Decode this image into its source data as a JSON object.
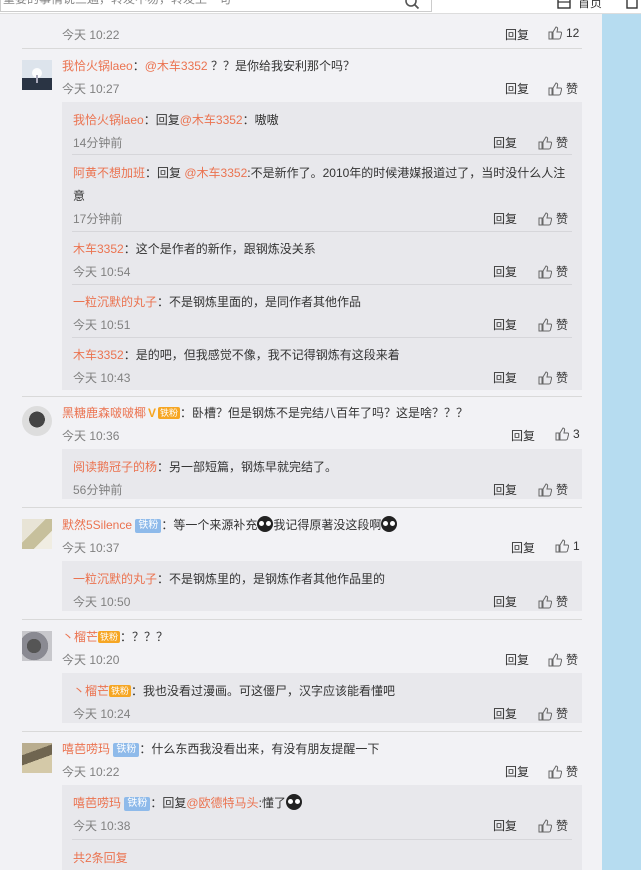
{
  "topbar": {
    "search_text": "重要的事情说三遍，转发不易，转发上一句",
    "home_label": "首页"
  },
  "labels": {
    "reply": "回复",
    "like_icon": "thumbs-up-icon"
  },
  "comments": [
    {
      "user": "",
      "text": "",
      "time": "今天 10:22",
      "likes": "12"
    },
    {
      "user": "我恰火锅laeo",
      "mention": "@木车3352",
      "text": "？？是你给我安利那个吗？",
      "time": "今天 10:27",
      "likes": "赞",
      "replies": [
        {
          "user": "我恰火锅laeo",
          "pre": "：回复",
          "mention": "@木车3352",
          "text": "：嗷嗷",
          "time": "14分钟前",
          "likes": "赞"
        },
        {
          "user": "阿黄不想加班",
          "pre": "：回复",
          "mention": "@木车3352",
          "text": ":不是新作了。2010年的时候港媒报道过了，当时没什么人注",
          "text2": "意",
          "time": "17分钟前",
          "likes": "赞"
        },
        {
          "user": "木车3352",
          "text": "：这个是作者的新作，跟钢炼没关系",
          "time": "今天 10:54",
          "likes": "赞"
        },
        {
          "user": "一粒沉默的丸子",
          "text": "：不是钢炼里面的，是同作者其他作品",
          "time": "今天 10:51",
          "likes": "赞"
        },
        {
          "user": "木车3352",
          "text": "：是的吧，但我感觉不像，我不记得钢炼有这段来着",
          "time": "今天 10:43",
          "likes": "赞"
        }
      ]
    },
    {
      "user": "黑糖鹿森啵啵椰",
      "badge": "铁粉",
      "text": "：卧槽？但是钢炼不是完结八百年了吗？这是啥？？？",
      "time": "今天 10:36",
      "likes": "3",
      "replies": [
        {
          "user": "阅读鹅冠子的杨",
          "text": "：另一部短篇，钢炼早就完结了。",
          "time": "56分钟前",
          "likes": "赞"
        }
      ]
    },
    {
      "user": "默然5Silence",
      "badge": "铁粉",
      "text": "：等一个来源补充",
      "text2": "我记得原著没这段啊",
      "time": "今天 10:37",
      "likes": "1",
      "replies": [
        {
          "user": "一粒沉默的丸子",
          "text": "：不是钢炼里的，是钢炼作者其他作品里的",
          "time": "今天 10:50",
          "likes": "赞"
        }
      ]
    },
    {
      "user": "丶榴芒",
      "badge": "铁粉",
      "text": "：？？？",
      "time": "今天 10:20",
      "likes": "赞",
      "replies": [
        {
          "user": "丶榴芒",
          "badge": "铁粉",
          "text": "：我也没看过漫画。可这僵尸，汉字应该能看懂吧",
          "time": "今天 10:24",
          "likes": "赞"
        }
      ]
    },
    {
      "user": "嘻芭唠玛",
      "badge": "铁粉",
      "text": "：什么东西我没看出来，有没有朋友提醒一下",
      "time": "今天 10:22",
      "likes": "赞",
      "replies": [
        {
          "user": "嘻芭唠玛",
          "badge": "铁粉",
          "pre": "：回复",
          "mention": "@欧德特马头",
          "text": ":懂了",
          "time": "今天 10:38",
          "likes": "赞"
        }
      ],
      "total": "共2条回复"
    }
  ]
}
